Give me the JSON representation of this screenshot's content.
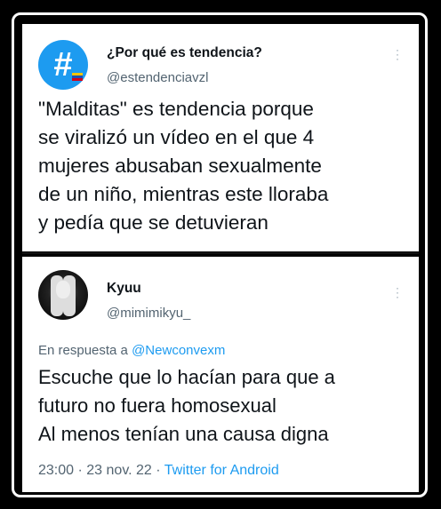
{
  "tweet1": {
    "avatar_icon": "hashtag-icon",
    "name": "¿Por qué es tendencia?",
    "handle": "@estendenciavzl",
    "text_lines": [
      "\"Malditas\" es tendencia porque",
      "se viralizó un vídeo en el que 4",
      "mujeres abusaban sexualmente",
      "de un niño, mientras este lloraba",
      "y pedía que se detuvieran"
    ]
  },
  "tweet2": {
    "name": "Kyuu",
    "handle": "@mimimikyu_",
    "reply_prefix": "En respuesta a",
    "reply_to": "@Newconvexm",
    "text_lines": [
      "Escuche que lo hacían para que a",
      "futuro no fuera homosexual",
      "Al menos tenían una causa digna"
    ],
    "time": "23:00",
    "date": "23 nov. 22",
    "source": "Twitter for Android"
  },
  "colors": {
    "accent": "#1d9bf0",
    "text": "#0f1419",
    "muted": "#536471",
    "background": "#000000"
  }
}
